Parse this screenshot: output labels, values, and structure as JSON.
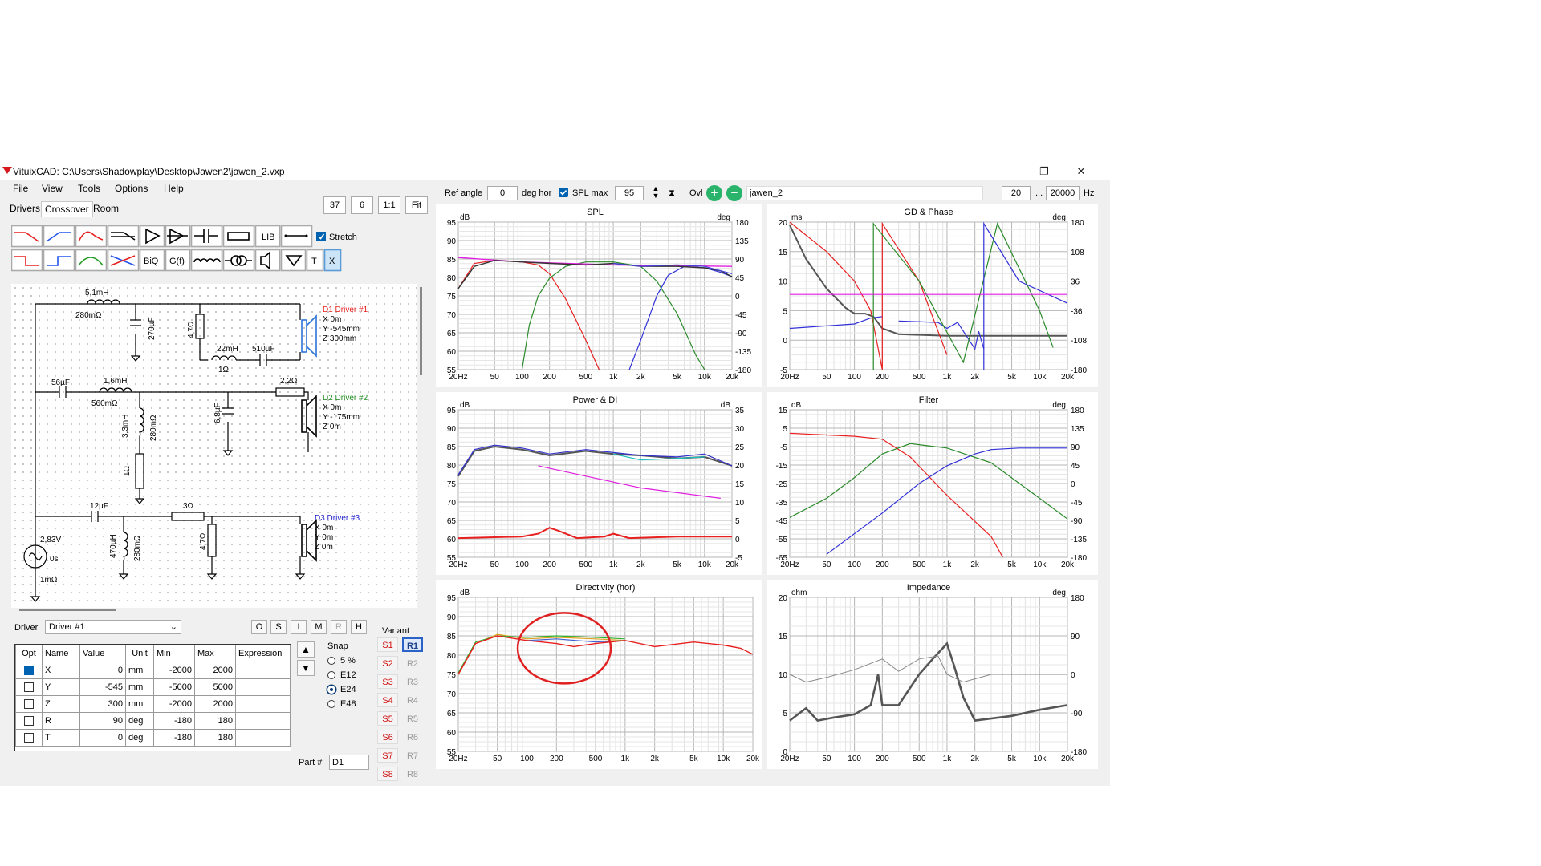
{
  "window": {
    "title": "VituixCAD: C:\\Users\\Shadowplay\\Desktop\\Jawen2\\jawen_2.vxp",
    "minimize": "–",
    "maximize": "❐",
    "close": "✕"
  },
  "menu": [
    "File",
    "View",
    "Tools",
    "Options",
    "Help"
  ],
  "tabs": [
    "Drivers",
    "Crossover",
    "Room"
  ],
  "active_tab": "Crossover",
  "view_buttons": {
    "zoom": "37",
    "grid": "6",
    "one_to_one": "1:1",
    "fit": "Fit"
  },
  "toolbar": {
    "lib": "LIB",
    "stretch_label": "Stretch",
    "stretch_checked": true,
    "biq": "BiQ",
    "gf": "G(f)",
    "t": "T",
    "x": "X"
  },
  "top_bar": {
    "ref_angle_label": "Ref angle",
    "ref_angle_value": "0",
    "deg_hor": "deg hor",
    "spl_max_label": "SPL max",
    "spl_max_checked": true,
    "spl_max_value": "95",
    "ovl_label": "Ovl",
    "overlay_name": "jawen_2",
    "freq_min": "20",
    "freq_sep": "...",
    "freq_max": "20000",
    "freq_unit": "Hz"
  },
  "schematic": {
    "components": [
      {
        "id": "L1",
        "name": "5,1mH",
        "sub": "280mΩ"
      },
      {
        "id": "C1",
        "name": "270µF"
      },
      {
        "id": "R1",
        "name": "4,7Ω"
      },
      {
        "id": "L2",
        "name": "22mH",
        "sub": "1Ω"
      },
      {
        "id": "C2",
        "name": "510µF"
      },
      {
        "id": "C3",
        "name": "56µF"
      },
      {
        "id": "L3",
        "name": "1,6mH",
        "sub": "560mΩ"
      },
      {
        "id": "R2",
        "name": "2,2Ω"
      },
      {
        "id": "L4",
        "name": "3,3mH",
        "sub": "280mΩ"
      },
      {
        "id": "C4",
        "name": "6,8µF"
      },
      {
        "id": "R3",
        "name": "1Ω"
      },
      {
        "id": "C5",
        "name": "12µF"
      },
      {
        "id": "R4",
        "name": "3Ω"
      },
      {
        "id": "L5",
        "name": "470µH",
        "sub": "280mΩ"
      },
      {
        "id": "R5",
        "name": "4,7Ω"
      }
    ],
    "source": {
      "voltage": "2,83V",
      "delay": "0s",
      "impedance": "1mΩ"
    },
    "drivers": [
      {
        "name": "D1 Driver #1",
        "x": "X 0m",
        "y": "Y -545mm",
        "z": "Z 300mm",
        "color": "#e8201f"
      },
      {
        "name": "D2 Driver #2",
        "x": "X 0m",
        "y": "Y -175mm",
        "z": "Z 0m",
        "color": "#1f8a1f"
      },
      {
        "name": "D3 Driver #3",
        "x": "X 0m",
        "y": "Y 0m",
        "z": "Z 0m",
        "color": "#2222cc"
      }
    ]
  },
  "driver_select": {
    "label": "Driver",
    "value": "Driver #1"
  },
  "osi_buttons": [
    "O",
    "S",
    "I",
    "M",
    "R",
    "H"
  ],
  "property_table": {
    "headers": [
      "Opt",
      "Name",
      "Value",
      "Unit",
      "Min",
      "Max",
      "Expression"
    ],
    "rows": [
      {
        "opt": true,
        "name": "X",
        "value": "0",
        "unit": "mm",
        "min": "-2000",
        "max": "2000",
        "expr": ""
      },
      {
        "opt": false,
        "name": "Y",
        "value": "-545",
        "unit": "mm",
        "min": "-5000",
        "max": "5000",
        "expr": ""
      },
      {
        "opt": false,
        "name": "Z",
        "value": "300",
        "unit": "mm",
        "min": "-2000",
        "max": "2000",
        "expr": ""
      },
      {
        "opt": false,
        "name": "R",
        "value": "90",
        "unit": "deg",
        "min": "-180",
        "max": "180",
        "expr": ""
      },
      {
        "opt": false,
        "name": "T",
        "value": "0",
        "unit": "deg",
        "min": "-180",
        "max": "180",
        "expr": ""
      }
    ]
  },
  "snap": {
    "label": "Snap",
    "options": [
      "5 %",
      "E12",
      "E24",
      "E48"
    ],
    "selected": "E24"
  },
  "part": {
    "label": "Part #",
    "value": "D1"
  },
  "variant": {
    "label": "Variant",
    "s": [
      "S1",
      "S2",
      "S3",
      "S4",
      "S5",
      "S6",
      "S7",
      "S8"
    ],
    "r": [
      "R1",
      "R2",
      "R3",
      "R4",
      "R5",
      "R6",
      "R7",
      "R8"
    ],
    "active_r": "R1"
  },
  "freq_ticks": [
    "20Hz",
    "50",
    "100",
    "200",
    "500",
    "1k",
    "2k",
    "5k",
    "10k",
    "20k"
  ],
  "charts": {
    "spl": {
      "title": "SPL",
      "left_unit": "dB",
      "right_unit": "deg",
      "left_ticks": [
        "95",
        "90",
        "85",
        "80",
        "75",
        "70",
        "65",
        "60",
        "55"
      ],
      "right_ticks": [
        "180",
        "135",
        "90",
        "45",
        "0",
        "-45",
        "-90",
        "-135",
        "-180"
      ]
    },
    "gd": {
      "title": "GD & Phase",
      "left_unit": "ms",
      "right_unit": "deg",
      "left_ticks": [
        "20",
        "15",
        "10",
        "5",
        "0",
        "-5"
      ],
      "right_ticks": [
        "180",
        "108",
        "36",
        "-36",
        "-108",
        "-180"
      ]
    },
    "power": {
      "title": "Power & DI",
      "left_unit": "dB",
      "right_unit": "dB",
      "left_ticks": [
        "95",
        "90",
        "85",
        "80",
        "75",
        "70",
        "65",
        "60",
        "55"
      ],
      "right_ticks": [
        "35",
        "30",
        "25",
        "20",
        "15",
        "10",
        "5",
        "0",
        "-5"
      ]
    },
    "filter": {
      "title": "Filter",
      "left_unit": "dB",
      "right_unit": "deg",
      "left_ticks": [
        "15",
        "5",
        "-5",
        "-15",
        "-25",
        "-35",
        "-45",
        "-55",
        "-65"
      ],
      "right_ticks": [
        "180",
        "135",
        "90",
        "45",
        "0",
        "-45",
        "-90",
        "-135",
        "-180"
      ]
    },
    "directivity": {
      "title": "Directivity (hor)",
      "left_unit": "dB",
      "left_ticks": [
        "95",
        "90",
        "85",
        "80",
        "75",
        "70",
        "65",
        "60",
        "55"
      ]
    },
    "impedance": {
      "title": "Impedance",
      "left_unit": "ohm",
      "right_unit": "deg",
      "left_ticks": [
        "20",
        "15",
        "10",
        "5",
        "0"
      ],
      "right_ticks": [
        "180",
        "90",
        "0",
        "-90",
        "-180"
      ]
    }
  },
  "colors": {
    "red": "#e8201f",
    "green": "#2a8a2a",
    "blue": "#3030d8",
    "magenta": "#e020e0",
    "gray": "#555555",
    "annotation": "#e02020",
    "accent": "#0063b1"
  }
}
